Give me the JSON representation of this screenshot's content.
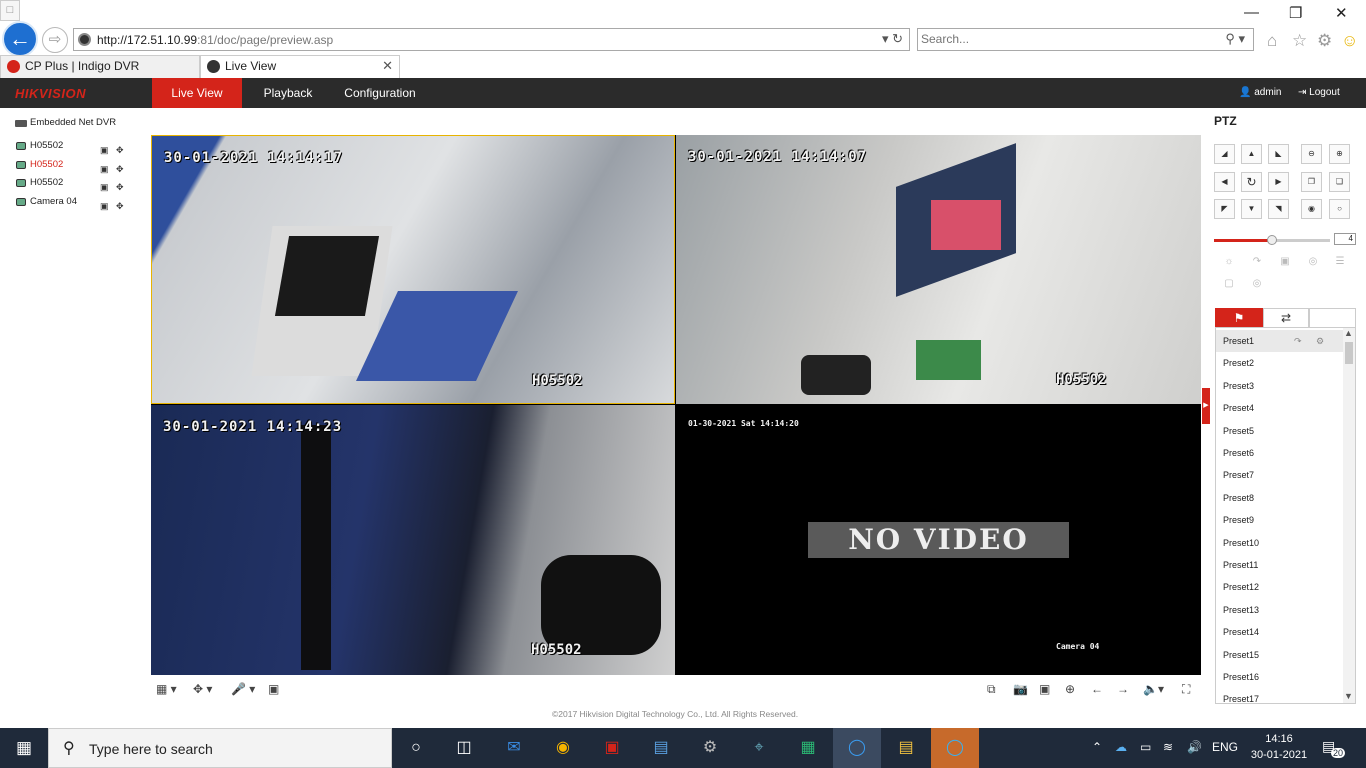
{
  "browser": {
    "url_host": "http://172.51.10.99",
    "url_rest": ":81/doc/page/preview.asp",
    "search_placeholder": "Search...",
    "tabs": [
      {
        "label": "CP Plus | Indigo DVR"
      },
      {
        "label": "Live View"
      }
    ]
  },
  "app": {
    "brand": "HIKVISION",
    "nav": [
      {
        "label": "Live View",
        "active": true
      },
      {
        "label": "Playback",
        "active": false
      },
      {
        "label": "Configuration",
        "active": false
      }
    ],
    "user": "admin",
    "logout": "Logout",
    "accent_color": "#d4241a"
  },
  "tree": {
    "root": "Embedded Net DVR",
    "cameras": [
      {
        "label": "H05502",
        "selected": false
      },
      {
        "label": "H05502",
        "selected": true
      },
      {
        "label": "H05502",
        "selected": false
      },
      {
        "label": "Camera 04",
        "selected": false
      }
    ]
  },
  "video": {
    "tiles": [
      {
        "timestamp": "30-01-2021  14:14:17",
        "name": "H05502"
      },
      {
        "timestamp": "30-01-2021  14:14:07",
        "name": "H05502"
      },
      {
        "timestamp": "30-01-2021  14:14:23",
        "name": "H05502"
      },
      {
        "timestamp": "01-30-2021 Sat 14:14:20",
        "name": "Camera 04",
        "no_video": "NO VIDEO"
      }
    ]
  },
  "footer": "©2017 Hikvision Digital Technology Co., Ltd. All Rights Reserved.",
  "ptz": {
    "title": "PTZ",
    "speed": "4",
    "speed_level": 0.5,
    "presets": [
      "Preset1",
      "Preset2",
      "Preset3",
      "Preset4",
      "Preset5",
      "Preset6",
      "Preset7",
      "Preset8",
      "Preset9",
      "Preset10",
      "Preset11",
      "Preset12",
      "Preset13",
      "Preset14",
      "Preset15",
      "Preset16",
      "Preset17"
    ]
  },
  "taskbar": {
    "search_text": "Type here to search",
    "lang": "ENG",
    "time": "14:16",
    "date": "30-01-2021",
    "notifications": "20"
  }
}
